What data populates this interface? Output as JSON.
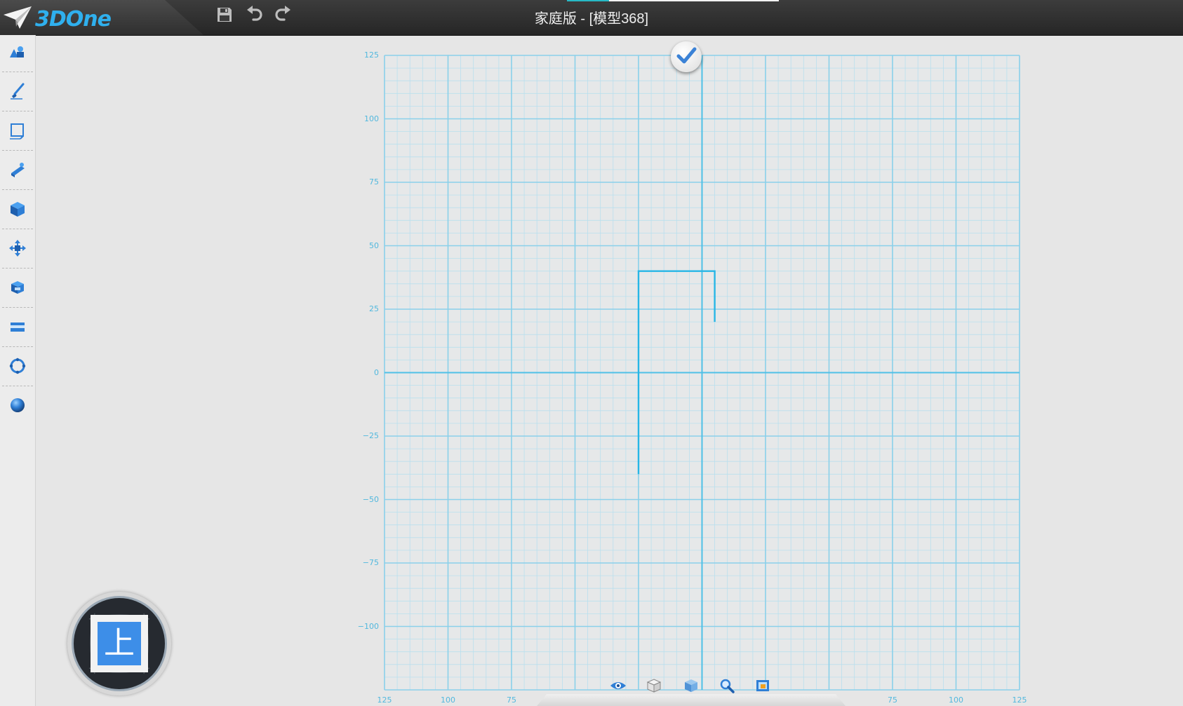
{
  "app": {
    "logo_text": "3DOne",
    "window_title": "家庭版 - [模型368]"
  },
  "quick_access": [
    {
      "icon": "save-icon"
    },
    {
      "icon": "undo-icon"
    },
    {
      "icon": "redo-icon"
    }
  ],
  "left_toolbar": [
    {
      "icon": "basic-solids-icon"
    },
    {
      "icon": "sketch-icon"
    },
    {
      "icon": "sketch-edit-icon"
    },
    {
      "icon": "feature-icon"
    },
    {
      "icon": "special-feature-icon"
    },
    {
      "icon": "transform-icon"
    },
    {
      "icon": "combine-icon"
    },
    {
      "icon": "distance-icon"
    },
    {
      "icon": "array-icon"
    },
    {
      "icon": "render-icon"
    }
  ],
  "grid": {
    "y_ticks": [
      "125",
      "100",
      "75",
      "50",
      "25",
      "0",
      "−25",
      "−50",
      "−75",
      "−100"
    ],
    "x_ticks": [
      "125",
      "100",
      "75",
      "75",
      "100",
      "125"
    ],
    "colors": {
      "minor": "#b9dfee",
      "major": "#8ad0ea",
      "axis": "#4fc0e6",
      "sketch": "#27b6e6"
    }
  },
  "sketch": {
    "polyline": [
      [
        -25,
        -40
      ],
      [
        -25,
        40
      ],
      [
        5,
        40
      ],
      [
        5,
        20
      ]
    ]
  },
  "view_cube": {
    "face_label": "上"
  },
  "bottom_toolbar": [
    {
      "icon": "eye-icon"
    },
    {
      "icon": "wireframe-cube-icon"
    },
    {
      "icon": "shaded-cube-icon"
    },
    {
      "icon": "zoom-icon"
    },
    {
      "icon": "frame-view-icon"
    }
  ]
}
